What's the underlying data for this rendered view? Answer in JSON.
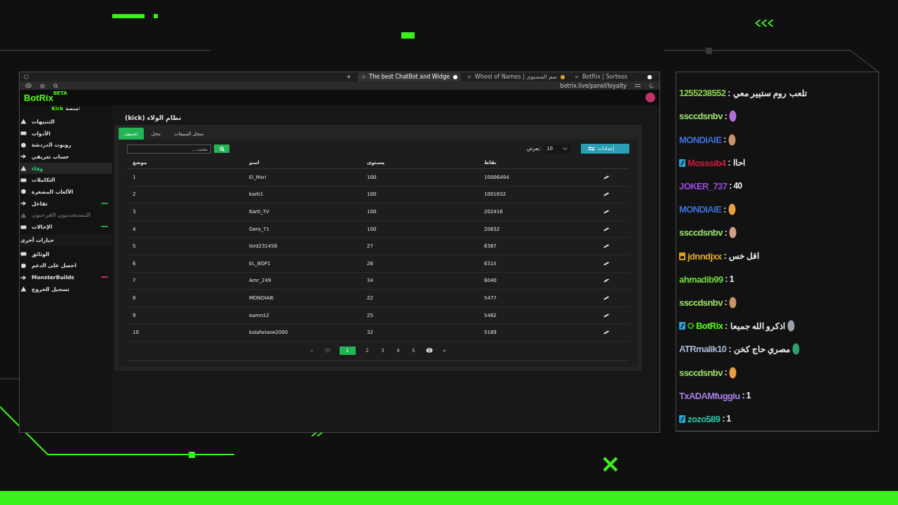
{
  "browser": {
    "tabs": [
      {
        "title": "BotRix | Sorteos",
        "selected": false
      },
      {
        "title": "Wheel of Names | سم المستوى",
        "selected": false
      },
      {
        "title": "The best ChatBot and Widge",
        "selected": true
      }
    ],
    "new_tab": "+",
    "close_mark": "×",
    "url": "botrix.live/panel/loyalty"
  },
  "app": {
    "logo": "BotRix",
    "logo_badge": "BETA",
    "platform_label": "منصة:",
    "platform": "Kick"
  },
  "sidebar": {
    "items": [
      {
        "label": "التنبيهات",
        "selected": false,
        "disabled": false
      },
      {
        "label": "الأدوات",
        "selected": false,
        "disabled": false
      },
      {
        "label": "روبوت الدردشة",
        "selected": false,
        "disabled": false
      },
      {
        "label": "حساب تعريفي",
        "selected": false,
        "disabled": false
      },
      {
        "label": "وفاء",
        "selected": true,
        "disabled": false
      },
      {
        "label": "التكاملات",
        "selected": false,
        "disabled": false
      },
      {
        "label": "الألعاب المصغرة",
        "selected": false,
        "disabled": false
      },
      {
        "label": "تفاعل",
        "selected": false,
        "disabled": false,
        "color": "#2ea043"
      },
      {
        "label": "المستخدمون الفرعيون",
        "selected": false,
        "disabled": true
      },
      {
        "label": "الإحالات",
        "selected": false,
        "disabled": false,
        "color": "#2ea043"
      }
    ],
    "section_title": "خيارات أخرى",
    "more_items": [
      {
        "label": "الوثائق",
        "selected": false,
        "disabled": false
      },
      {
        "label": "احصل على الدعم",
        "selected": false,
        "disabled": false
      },
      {
        "label": "MonsterBuilds",
        "selected": false,
        "disabled": false,
        "color": "#c0304a"
      },
      {
        "label": "تسجيل الخروج",
        "selected": false,
        "disabled": false
      }
    ]
  },
  "page_title": "نظام الولاء (kick)",
  "tabs": [
    {
      "label": "سجل المبيعات",
      "selected": false
    },
    {
      "label": "محل",
      "selected": false
    },
    {
      "label": "تصنيف",
      "selected": true
    }
  ],
  "search": {
    "placeholder": "بحث..."
  },
  "per_page": {
    "label": "يعرض:",
    "value": "10"
  },
  "settings_button": "إعدادات",
  "table": {
    "columns": [
      "نقاط",
      "مستوى",
      "اسم",
      "موضع"
    ],
    "rows": [
      [
        "10006494",
        "100",
        "El_Msri",
        "1"
      ],
      [
        "1001832",
        "100",
        "karti1",
        "2"
      ],
      [
        "202416",
        "100",
        "Karti_TV",
        "3"
      ],
      [
        "20832",
        "100",
        "Gero_T1",
        "4"
      ],
      [
        "6387",
        "27",
        "lord231456",
        "5"
      ],
      [
        "6315",
        "26",
        "EL_BOP1",
        "6"
      ],
      [
        "6040",
        "34",
        "Amr_249",
        "7"
      ],
      [
        "5477",
        "22",
        "MONDIAIE",
        "8"
      ],
      [
        "5462",
        "25",
        "eamn12",
        "9"
      ],
      [
        "5189",
        "32",
        "kalafwlaoe2000",
        "10"
      ]
    ]
  },
  "pagination": {
    "last": "»",
    "pages": [
      {
        "label": "5",
        "selected": false
      },
      {
        "label": "4",
        "selected": false
      },
      {
        "label": "3",
        "selected": false
      },
      {
        "label": "2",
        "selected": false
      },
      {
        "label": "1",
        "selected": true
      }
    ],
    "first": "«"
  },
  "chat": {
    "messages": [
      {
        "user": "1255238552",
        "color": "#8fd14f",
        "kind": "text",
        "text": ": تلعب روم ستيير معي"
      },
      {
        "user": "ssccdsnbv",
        "color": "#9be26a",
        "kind": "emote",
        "text": ":"
      },
      {
        "user": "MONDIAIE",
        "color": "#3d6fd8",
        "kind": "emote",
        "text": ":"
      },
      {
        "user": "Mosssib4",
        "color": "#c81e3c",
        "kind": "text",
        "text": ": احاا",
        "badges": [
          {
            "kind": "sub"
          }
        ]
      },
      {
        "user": "JOKER_737",
        "color": "#9a4ae0",
        "kind": "text",
        "text": ": 40"
      },
      {
        "user": "MONDIAIE",
        "color": "#3d6fd8",
        "kind": "emote",
        "text": ":"
      },
      {
        "user": "ssccdsnbv",
        "color": "#9be26a",
        "kind": "emote",
        "text": ":"
      },
      {
        "user": "jdnndjxx",
        "color": "#e0a82a",
        "kind": "text",
        "text": ": اقل خس",
        "badges": [
          {
            "kind": "vip"
          }
        ]
      },
      {
        "user": "ahmadib99",
        "color": "#6fd63c",
        "kind": "text",
        "text": ": 1"
      },
      {
        "user": "ssccdsnbv",
        "color": "#9be26a",
        "kind": "emote",
        "text": ":"
      },
      {
        "user": "BotRix",
        "color": "#53fc18",
        "kind": "text_emote",
        "text": ": اذكرو الله جميعا",
        "badges": [
          {
            "kind": "sub"
          },
          {
            "kind": "bot"
          }
        ]
      },
      {
        "user": "ATRmalik10",
        "color": "#a8b8d8",
        "kind": "text_emote",
        "text": ": مصري حاج كخن"
      },
      {
        "user": "ssccdsnbv",
        "color": "#9be26a",
        "kind": "emote",
        "text": ":"
      },
      {
        "user": "TxADAMfuggiu",
        "color": "#a682e6",
        "kind": "text",
        "text": ": 1"
      },
      {
        "user": "zozo589",
        "color": "#2ec4a4",
        "kind": "text",
        "text": ": 1",
        "badges": [
          {
            "kind": "sub"
          }
        ]
      }
    ]
  }
}
